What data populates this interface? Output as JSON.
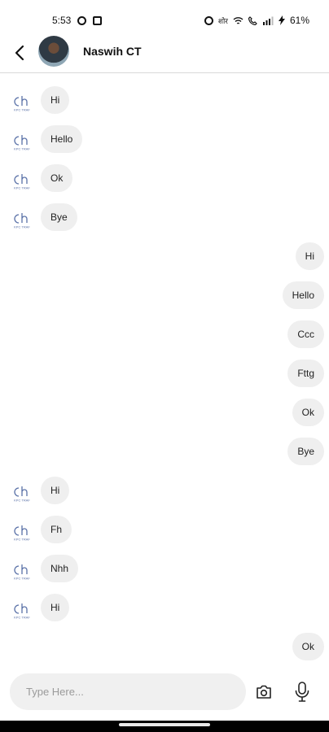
{
  "status_bar": {
    "time": "5:53",
    "battery": "61%",
    "network_label": "शोर"
  },
  "header": {
    "contact_name": "Naswih CT"
  },
  "bot_logo_text": "KPC TRAF",
  "messages": [
    {
      "side": "left",
      "text": "Hi"
    },
    {
      "side": "left",
      "text": "Hello"
    },
    {
      "side": "left",
      "text": "Ok"
    },
    {
      "side": "left",
      "text": "Bye"
    },
    {
      "side": "right",
      "text": "Hi"
    },
    {
      "side": "right",
      "text": "Hello"
    },
    {
      "side": "right",
      "text": "Ccc"
    },
    {
      "side": "right",
      "text": "Fttg"
    },
    {
      "side": "right",
      "text": "Ok"
    },
    {
      "side": "right",
      "text": "Bye"
    },
    {
      "side": "left",
      "text": "Hi"
    },
    {
      "side": "left",
      "text": "Fh"
    },
    {
      "side": "left",
      "text": "Nhh"
    },
    {
      "side": "left",
      "text": "Hi"
    },
    {
      "side": "right",
      "text": "Ok"
    }
  ],
  "input": {
    "placeholder": "Type Here..."
  },
  "icons": {
    "back": "back-arrow-icon",
    "camera": "camera-icon",
    "mic": "microphone-icon"
  }
}
